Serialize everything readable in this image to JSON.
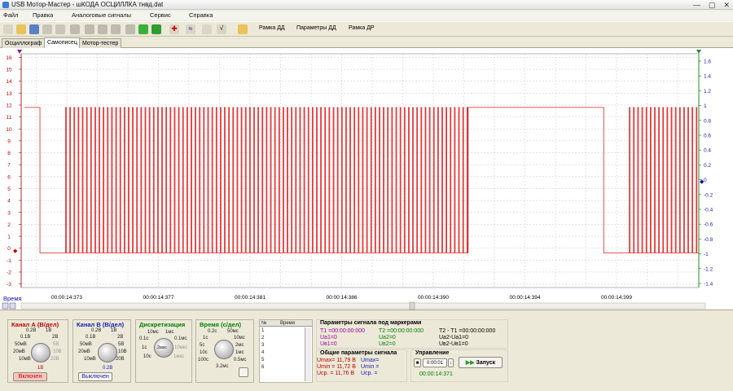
{
  "window": {
    "title": "USB Мотор-Мастер - шКОДА ОСЦИЛЛКА тнвд.dat"
  },
  "menu": [
    "Файл",
    "Правка",
    "Аналоговые сигналы",
    "Сервис",
    "Справка"
  ],
  "toolbar": {
    "ramka_dd": "Рамка ДД",
    "params_dd": "Параметры ДД",
    "ramka_dr": "Рамка ДР"
  },
  "tabs": [
    "Осциллограф",
    "Самописец",
    "Мотор-тестер"
  ],
  "active_tab": "Самописец",
  "chart_data": {
    "type": "line",
    "left_axis": {
      "min": -3,
      "max": 16,
      "ticks": [
        "16",
        "15",
        "14",
        "13",
        "12",
        "11",
        "10",
        "9",
        "8",
        "7",
        "6",
        "5",
        "4",
        "3",
        "2",
        "1",
        "0",
        "-1",
        "-2",
        "-3"
      ]
    },
    "right_axis": {
      "min": -1.4,
      "max": 1.6,
      "ticks": [
        "1.6",
        "1.4",
        "1.2",
        "1",
        "0.8",
        "0.6",
        "0.4",
        "0.2",
        "0",
        "-0.2",
        "-0.4",
        "-0.6",
        "-0.8",
        "-1",
        "-1.2",
        "-1.4"
      ]
    },
    "x_ticks": [
      "00:00:14:373",
      "00:00:14:377",
      "00:00:14:381",
      "00:00:14:386",
      "00:00:14:390",
      "00:00:14:394",
      "00:00:14:399"
    ],
    "xlabel": "Время",
    "signal_high": 11.8,
    "signal_low": -0.4,
    "series_color": "#e02020",
    "segments": [
      {
        "type": "high",
        "t0": 0,
        "t1": 0.023
      },
      {
        "type": "low",
        "t0": 0.023,
        "t1": 0.061
      },
      {
        "type": "pulses",
        "t0": 0.061,
        "t1": 0.658,
        "period": 0.0062
      },
      {
        "type": "high",
        "t0": 0.658,
        "t1": 0.859
      },
      {
        "type": "low",
        "t0": 0.859,
        "t1": 0.897
      },
      {
        "type": "pulses",
        "t0": 0.897,
        "t1": 1.0,
        "period": 0.0062
      }
    ]
  },
  "chA": {
    "title": "Канал А (В/дел)",
    "knob_labels": [
      "0.2В",
      "1В",
      "0.1В",
      "2В",
      "50мВ",
      "5В",
      "20мВ",
      "10В",
      "10мВ",
      "20В"
    ],
    "selected": "1В",
    "status": "Включен"
  },
  "chB": {
    "title": "Канал В (В/дел)",
    "knob_labels": [
      "0.2В",
      "1В",
      "0.1В",
      "2В",
      "50мВ",
      "5В",
      "20мВ",
      "10В",
      "10мВ",
      "20В"
    ],
    "selected": "0.2В",
    "status": "Выключен"
  },
  "disc": {
    "title": "Дискретизация",
    "knob_labels": [
      "10мс",
      "1мс",
      "0.1с",
      "0.1мс",
      "1с",
      "10мкс",
      "10с",
      "1мкс"
    ],
    "selected": "2мкс"
  },
  "time": {
    "title": "Время (с/дел)",
    "knob_labels": [
      "0.2с",
      "50мс",
      "1с",
      "10мс",
      "5с",
      "2мс",
      "10с",
      "1мс",
      "100с",
      "0.5мс"
    ],
    "selected": "3.2мс"
  },
  "table": {
    "col1": "№",
    "col2": "Время",
    "rows": [
      "1",
      "2",
      "3",
      "4",
      "5",
      "6"
    ]
  },
  "marker_params": {
    "title": "Параметры сигнала под маркерами",
    "t1": "T1 =00:00:00:000",
    "ua1": "Uа1=0",
    "ub1": "Uв1=0",
    "t2": "T2 =00:00:00:000",
    "ua2": "Uа2=0",
    "ub2": "Uв2=0",
    "dt": "T2 - T1 =00:00:00:000",
    "dua": "Uа2-Uа1=0",
    "dub": "Uв2-Uв1=0"
  },
  "general_params": {
    "title": "Общие параметры сигнала",
    "umax_a": "Umax= 11,79 В",
    "umin_a": "Umin = 11,72 В",
    "usr_a": "Uср. = 11,76 В",
    "umax_b": "Umax=",
    "umin_b": "Umin =",
    "usr_b": "Uср. ="
  },
  "control": {
    "title": "Управление",
    "time_value": "0:00:01",
    "run_label": "Запуск",
    "timestamp": "00:00:14:371"
  }
}
